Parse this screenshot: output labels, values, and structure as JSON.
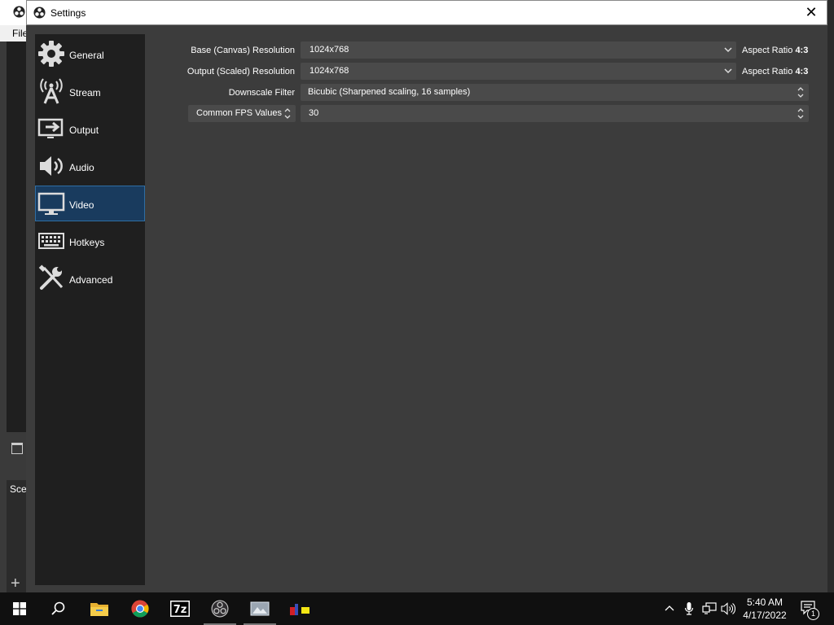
{
  "window": {
    "title": "Settings",
    "close_glyph": "✕"
  },
  "background_app": {
    "menu_file": "File",
    "panel_scenes": "Scenes"
  },
  "sidebar": {
    "items": [
      {
        "label": "General",
        "icon": "gear-icon"
      },
      {
        "label": "Stream",
        "icon": "broadcast-tower-icon"
      },
      {
        "label": "Output",
        "icon": "output-monitor-icon"
      },
      {
        "label": "Audio",
        "icon": "speaker-icon"
      },
      {
        "label": "Video",
        "icon": "monitor-icon",
        "active": true
      },
      {
        "label": "Hotkeys",
        "icon": "keyboard-icon"
      },
      {
        "label": "Advanced",
        "icon": "tools-icon"
      }
    ]
  },
  "video": {
    "base_resolution": {
      "label": "Base (Canvas) Resolution",
      "value": "1024x768",
      "aspect_label": "Aspect Ratio",
      "aspect_value": "4:3"
    },
    "output_resolution": {
      "label": "Output (Scaled) Resolution",
      "value": "1024x768",
      "aspect_label": "Aspect Ratio",
      "aspect_value": "4:3"
    },
    "downscale_filter": {
      "label": "Downscale Filter",
      "value": "Bicubic (Sharpened scaling, 16 samples)"
    },
    "fps": {
      "label": "Common FPS Values",
      "value": "30"
    }
  },
  "taskbar": {
    "apps": [
      "start-icon",
      "search-icon",
      "file-explorer-icon",
      "chrome-icon",
      "7zip-icon",
      "obs-icon",
      "image-viewer-icon",
      "app-icon"
    ],
    "time": "5:40 AM",
    "date": "4/17/2022",
    "notification_count": "1"
  },
  "colors": {
    "accent_selected": "#193b5e",
    "sidebar_bg": "#1f1f1f",
    "panel_bg": "#3c3c3c",
    "combo_bg": "#4a4a4a"
  }
}
